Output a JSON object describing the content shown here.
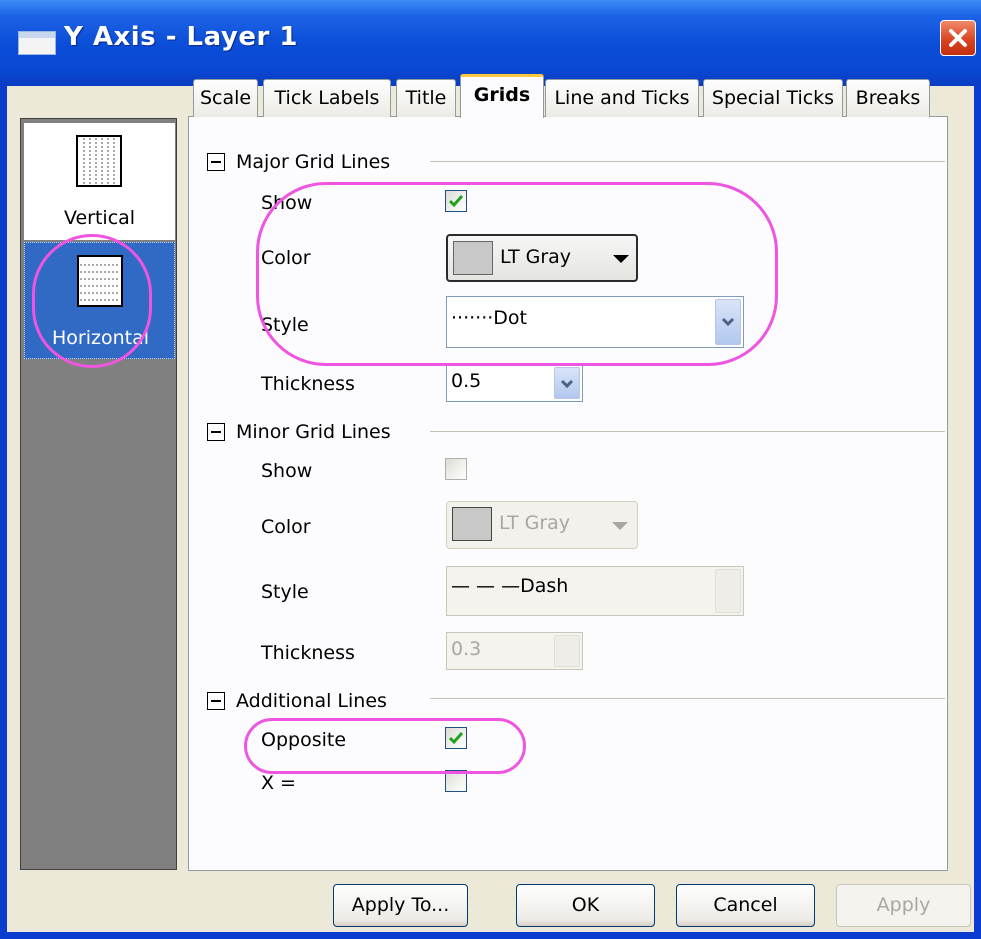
{
  "window": {
    "title": "Y Axis - Layer 1"
  },
  "tabs": [
    {
      "label": "Scale"
    },
    {
      "label": "Tick Labels"
    },
    {
      "label": "Title"
    },
    {
      "label": "Grids",
      "active": true
    },
    {
      "label": "Line and Ticks"
    },
    {
      "label": "Special Ticks"
    },
    {
      "label": "Breaks"
    }
  ],
  "sidebar": {
    "items": [
      {
        "label": "Vertical",
        "icon": "vertical-grid-icon",
        "selected": false
      },
      {
        "label": "Horizontal",
        "icon": "horizontal-grid-icon",
        "selected": true
      }
    ]
  },
  "major": {
    "title": "Major Grid Lines",
    "show_label": "Show",
    "show_checked": true,
    "color_label": "Color",
    "color_value": "LT Gray",
    "style_label": "Style",
    "style_value": "·······Dot",
    "thickness_label": "Thickness",
    "thickness_value": "0.5"
  },
  "minor": {
    "title": "Minor Grid Lines",
    "show_label": "Show",
    "show_checked": false,
    "color_label": "Color",
    "color_value": "LT Gray",
    "style_label": "Style",
    "style_value": "— — —Dash",
    "thickness_label": "Thickness",
    "thickness_value": "0.3"
  },
  "additional": {
    "title": "Additional Lines",
    "opposite_label": "Opposite",
    "opposite_checked": true,
    "x_label": "X =",
    "x_checked": false
  },
  "buttons": {
    "apply_to": "Apply To...",
    "ok": "OK",
    "cancel": "Cancel",
    "apply": "Apply"
  },
  "colors": {
    "titlebar": "#0a48d2",
    "swatch": "#c8c8c8",
    "highlight": "#ee55e0",
    "selected_item": "#316ac5"
  }
}
